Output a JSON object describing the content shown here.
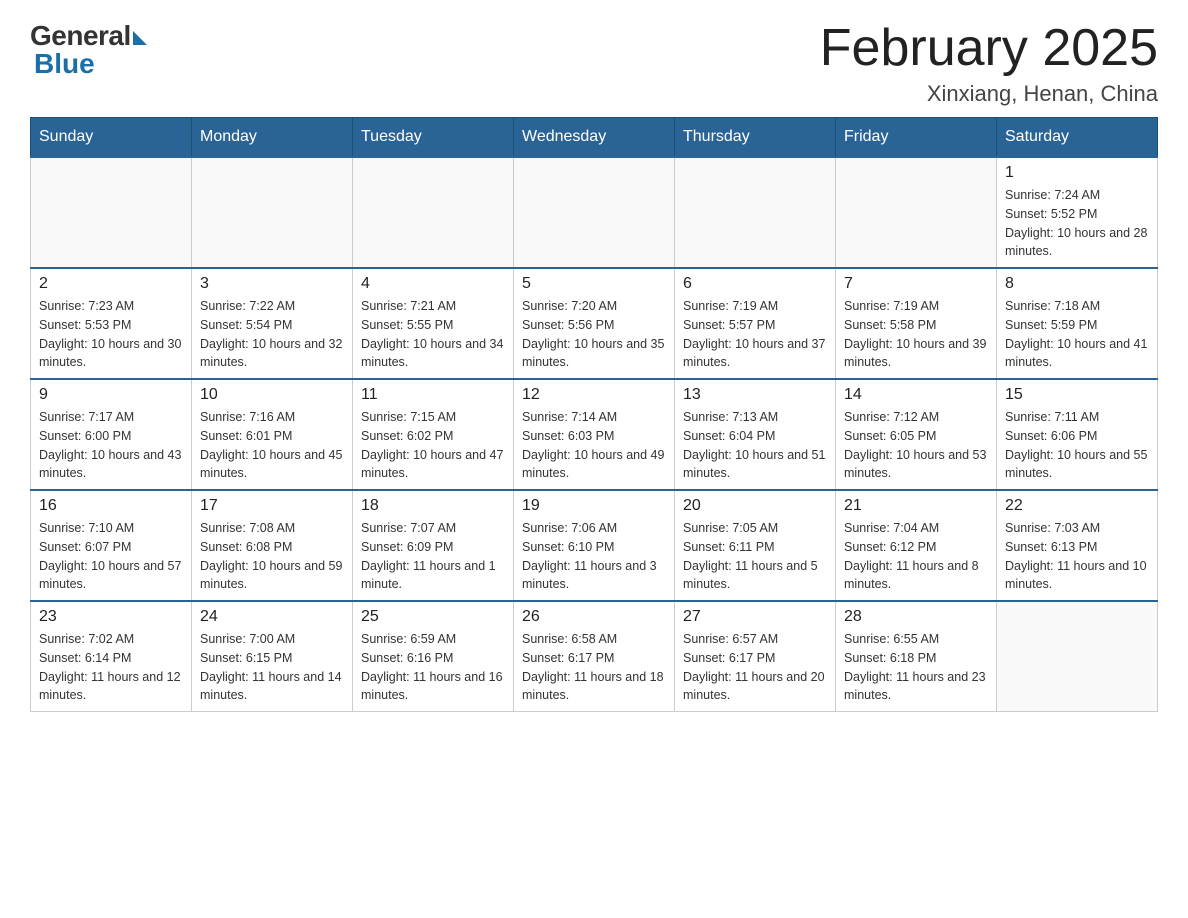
{
  "header": {
    "logo_general": "General",
    "logo_blue": "Blue",
    "month_title": "February 2025",
    "location": "Xinxiang, Henan, China"
  },
  "days_of_week": [
    "Sunday",
    "Monday",
    "Tuesday",
    "Wednesday",
    "Thursday",
    "Friday",
    "Saturday"
  ],
  "weeks": [
    [
      {
        "day": "",
        "info": ""
      },
      {
        "day": "",
        "info": ""
      },
      {
        "day": "",
        "info": ""
      },
      {
        "day": "",
        "info": ""
      },
      {
        "day": "",
        "info": ""
      },
      {
        "day": "",
        "info": ""
      },
      {
        "day": "1",
        "info": "Sunrise: 7:24 AM\nSunset: 5:52 PM\nDaylight: 10 hours and 28 minutes."
      }
    ],
    [
      {
        "day": "2",
        "info": "Sunrise: 7:23 AM\nSunset: 5:53 PM\nDaylight: 10 hours and 30 minutes."
      },
      {
        "day": "3",
        "info": "Sunrise: 7:22 AM\nSunset: 5:54 PM\nDaylight: 10 hours and 32 minutes."
      },
      {
        "day": "4",
        "info": "Sunrise: 7:21 AM\nSunset: 5:55 PM\nDaylight: 10 hours and 34 minutes."
      },
      {
        "day": "5",
        "info": "Sunrise: 7:20 AM\nSunset: 5:56 PM\nDaylight: 10 hours and 35 minutes."
      },
      {
        "day": "6",
        "info": "Sunrise: 7:19 AM\nSunset: 5:57 PM\nDaylight: 10 hours and 37 minutes."
      },
      {
        "day": "7",
        "info": "Sunrise: 7:19 AM\nSunset: 5:58 PM\nDaylight: 10 hours and 39 minutes."
      },
      {
        "day": "8",
        "info": "Sunrise: 7:18 AM\nSunset: 5:59 PM\nDaylight: 10 hours and 41 minutes."
      }
    ],
    [
      {
        "day": "9",
        "info": "Sunrise: 7:17 AM\nSunset: 6:00 PM\nDaylight: 10 hours and 43 minutes."
      },
      {
        "day": "10",
        "info": "Sunrise: 7:16 AM\nSunset: 6:01 PM\nDaylight: 10 hours and 45 minutes."
      },
      {
        "day": "11",
        "info": "Sunrise: 7:15 AM\nSunset: 6:02 PM\nDaylight: 10 hours and 47 minutes."
      },
      {
        "day": "12",
        "info": "Sunrise: 7:14 AM\nSunset: 6:03 PM\nDaylight: 10 hours and 49 minutes."
      },
      {
        "day": "13",
        "info": "Sunrise: 7:13 AM\nSunset: 6:04 PM\nDaylight: 10 hours and 51 minutes."
      },
      {
        "day": "14",
        "info": "Sunrise: 7:12 AM\nSunset: 6:05 PM\nDaylight: 10 hours and 53 minutes."
      },
      {
        "day": "15",
        "info": "Sunrise: 7:11 AM\nSunset: 6:06 PM\nDaylight: 10 hours and 55 minutes."
      }
    ],
    [
      {
        "day": "16",
        "info": "Sunrise: 7:10 AM\nSunset: 6:07 PM\nDaylight: 10 hours and 57 minutes."
      },
      {
        "day": "17",
        "info": "Sunrise: 7:08 AM\nSunset: 6:08 PM\nDaylight: 10 hours and 59 minutes."
      },
      {
        "day": "18",
        "info": "Sunrise: 7:07 AM\nSunset: 6:09 PM\nDaylight: 11 hours and 1 minute."
      },
      {
        "day": "19",
        "info": "Sunrise: 7:06 AM\nSunset: 6:10 PM\nDaylight: 11 hours and 3 minutes."
      },
      {
        "day": "20",
        "info": "Sunrise: 7:05 AM\nSunset: 6:11 PM\nDaylight: 11 hours and 5 minutes."
      },
      {
        "day": "21",
        "info": "Sunrise: 7:04 AM\nSunset: 6:12 PM\nDaylight: 11 hours and 8 minutes."
      },
      {
        "day": "22",
        "info": "Sunrise: 7:03 AM\nSunset: 6:13 PM\nDaylight: 11 hours and 10 minutes."
      }
    ],
    [
      {
        "day": "23",
        "info": "Sunrise: 7:02 AM\nSunset: 6:14 PM\nDaylight: 11 hours and 12 minutes."
      },
      {
        "day": "24",
        "info": "Sunrise: 7:00 AM\nSunset: 6:15 PM\nDaylight: 11 hours and 14 minutes."
      },
      {
        "day": "25",
        "info": "Sunrise: 6:59 AM\nSunset: 6:16 PM\nDaylight: 11 hours and 16 minutes."
      },
      {
        "day": "26",
        "info": "Sunrise: 6:58 AM\nSunset: 6:17 PM\nDaylight: 11 hours and 18 minutes."
      },
      {
        "day": "27",
        "info": "Sunrise: 6:57 AM\nSunset: 6:17 PM\nDaylight: 11 hours and 20 minutes."
      },
      {
        "day": "28",
        "info": "Sunrise: 6:55 AM\nSunset: 6:18 PM\nDaylight: 11 hours and 23 minutes."
      },
      {
        "day": "",
        "info": ""
      }
    ]
  ]
}
